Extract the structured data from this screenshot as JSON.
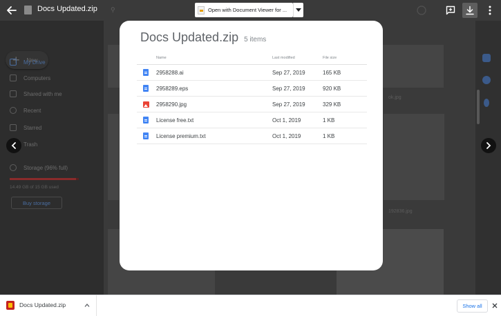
{
  "viewer": {
    "file_title": "Docs Updated.zip",
    "open_with_label": "Open with Document Viewer for ..."
  },
  "background": {
    "new_label": "New",
    "nav": [
      {
        "label": "My Drive",
        "active": true
      },
      {
        "label": "Computers",
        "active": false
      },
      {
        "label": "Shared with me",
        "active": false
      },
      {
        "label": "Recent",
        "active": false
      },
      {
        "label": "Starred",
        "active": false
      },
      {
        "label": "Trash",
        "active": false
      },
      {
        "label": "Storage (96% full)",
        "active": false
      }
    ],
    "storage_used_text": "14.49 GB of 15 GB used",
    "storage_fraction": 0.96,
    "buy_storage_label": "Buy storage",
    "tile_caption_1": "ok.jpg",
    "tile_caption_2": "192836.jpg"
  },
  "zip": {
    "title": "Docs Updated.zip",
    "count": "5 items",
    "columns": {
      "name": "Name",
      "modified": "Last modified",
      "size": "File size"
    },
    "files": [
      {
        "name": "2958288.ai",
        "modified": "Sep 27, 2019",
        "size": "165 KB",
        "icon": "doc-icon"
      },
      {
        "name": "2958289.eps",
        "modified": "Sep 27, 2019",
        "size": "920 KB",
        "icon": "doc-icon"
      },
      {
        "name": "2958290.jpg",
        "modified": "Sep 27, 2019",
        "size": "329 KB",
        "icon": "image-icon"
      },
      {
        "name": "License free.txt",
        "modified": "Oct 1, 2019",
        "size": "1 KB",
        "icon": "doc-icon"
      },
      {
        "name": "License premium.txt",
        "modified": "Oct 1, 2019",
        "size": "1 KB",
        "icon": "doc-icon"
      }
    ]
  },
  "downloads": {
    "file_name": "Docs Updated.zip",
    "show_all_label": "Show all"
  },
  "colors": {
    "accent": "#1a73e8",
    "doc_icon": "#4285f4",
    "image_icon": "#ea4335"
  }
}
